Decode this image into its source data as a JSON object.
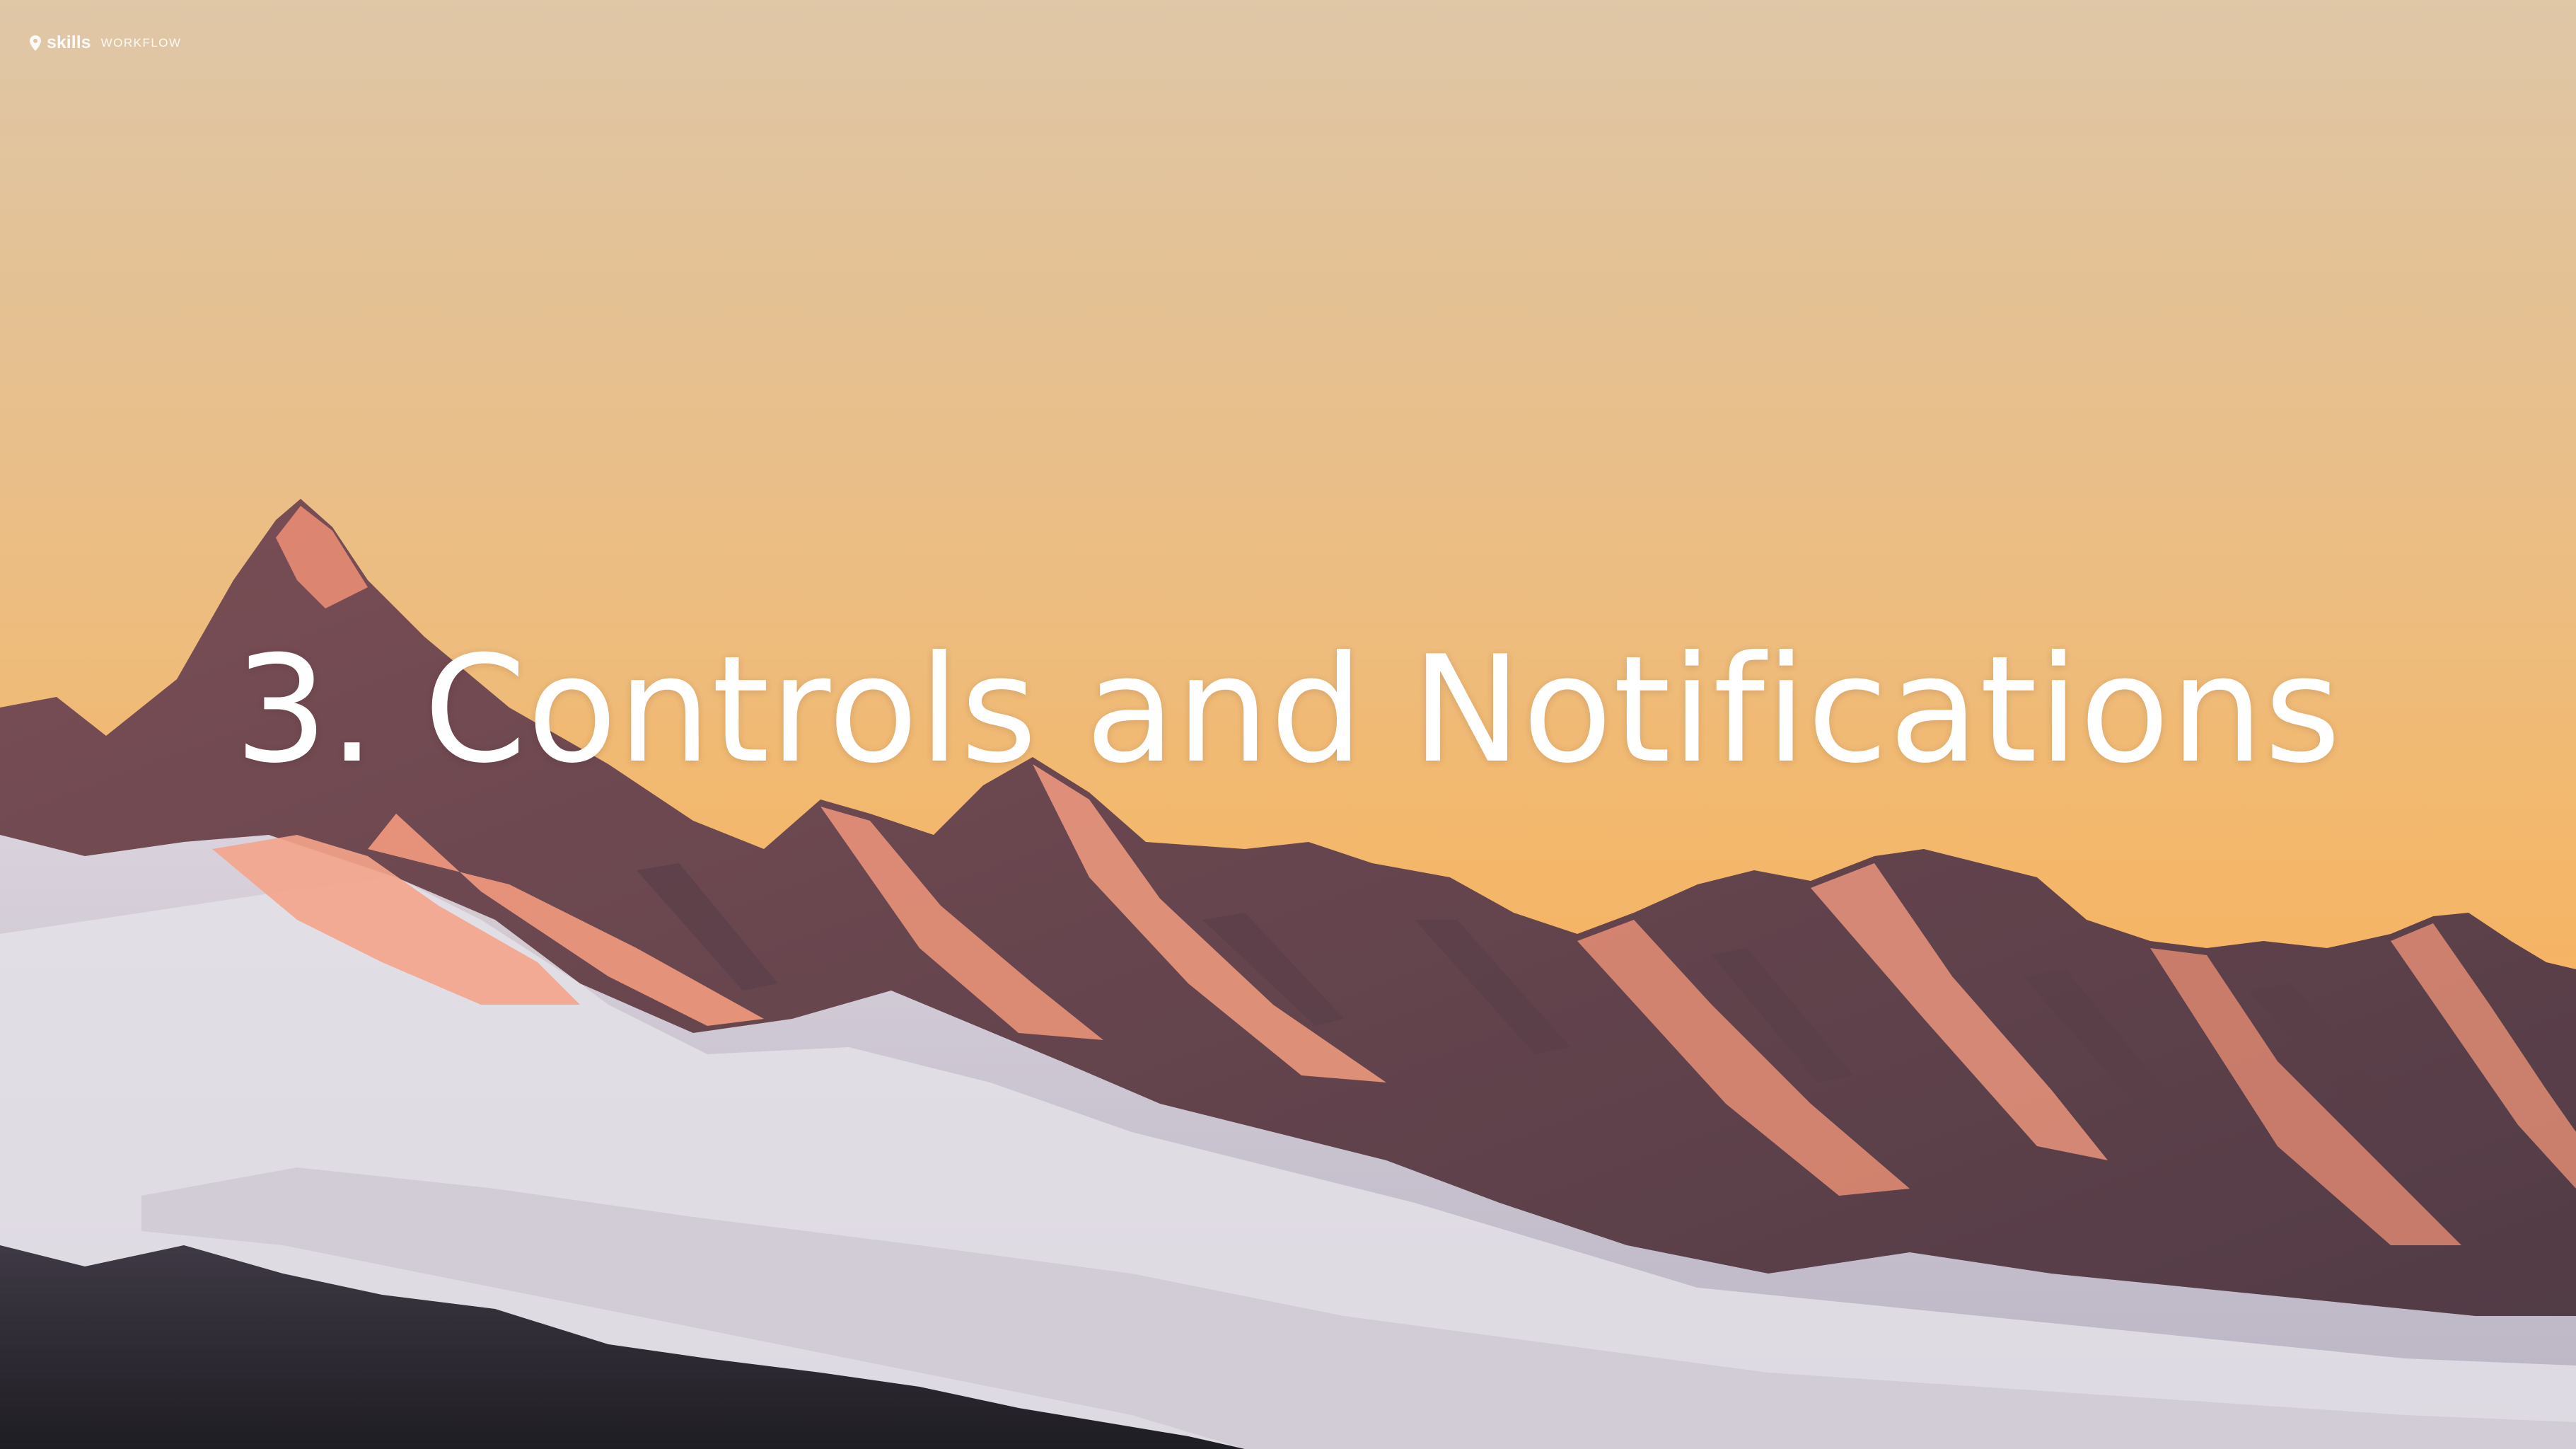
{
  "slide": {
    "title": "3. Controls and Notifications"
  },
  "brand": {
    "name": "skills",
    "subtitle": "WORKFLOW",
    "icon": "location-pin-icon"
  },
  "background": {
    "scene": "snowy-mountain-range-at-sunset",
    "sky_top_color": "#dfc7a7",
    "sky_bottom_color": "#f6b363",
    "snow_color": "#e6e2ea",
    "alpenglow_color": "#f28c73",
    "rock_color": "#5c4048"
  }
}
